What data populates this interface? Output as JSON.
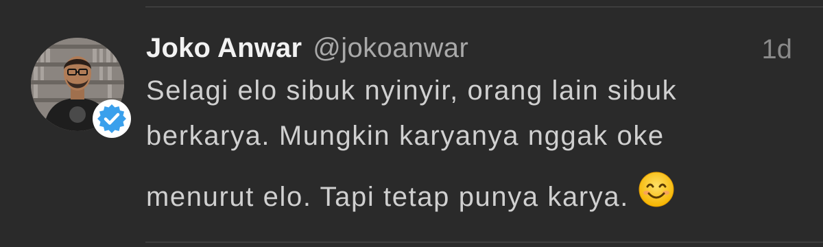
{
  "tweet": {
    "author_name": "Joko Anwar",
    "author_handle": "@jokoanwar",
    "timestamp": "1d",
    "verified": true,
    "lines": [
      "Selagi elo sibuk nyinyir, orang lain sibuk",
      "berkarya. Mungkin karyanya nggak oke",
      "menurut elo. Tapi tetap punya karya."
    ],
    "emoji": "smiling-face-icon"
  },
  "colors": {
    "background": "#2a2a2a",
    "name": "#f2f2f2",
    "handle": "#a9a9a9",
    "body": "#d0d0d0",
    "timestamp": "#8a8a8a",
    "verified_badge": "#3aa0ec",
    "divider": "#3d3d3d"
  }
}
